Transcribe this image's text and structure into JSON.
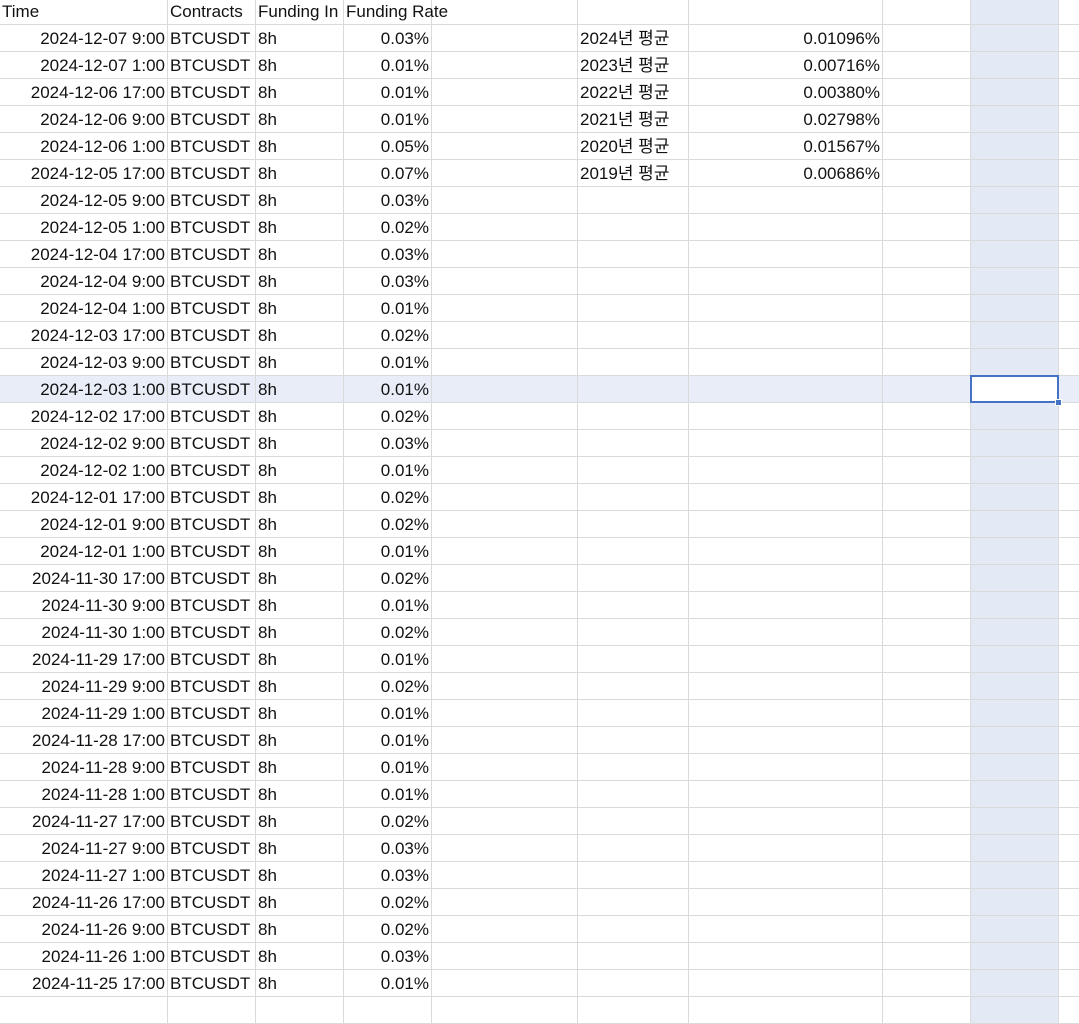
{
  "spreadsheet": {
    "headers": [
      "Time",
      "Contracts",
      "Funding In",
      "Funding Rate"
    ],
    "rows": [
      [
        "2024-12-07 9:00",
        "BTCUSDT",
        "8h",
        "0.03%"
      ],
      [
        "2024-12-07 1:00",
        "BTCUSDT",
        "8h",
        "0.01%"
      ],
      [
        "2024-12-06 17:00",
        "BTCUSDT",
        "8h",
        "0.01%"
      ],
      [
        "2024-12-06 9:00",
        "BTCUSDT",
        "8h",
        "0.01%"
      ],
      [
        "2024-12-06 1:00",
        "BTCUSDT",
        "8h",
        "0.05%"
      ],
      [
        "2024-12-05 17:00",
        "BTCUSDT",
        "8h",
        "0.07%"
      ],
      [
        "2024-12-05 9:00",
        "BTCUSDT",
        "8h",
        "0.03%"
      ],
      [
        "2024-12-05 1:00",
        "BTCUSDT",
        "8h",
        "0.02%"
      ],
      [
        "2024-12-04 17:00",
        "BTCUSDT",
        "8h",
        "0.03%"
      ],
      [
        "2024-12-04 9:00",
        "BTCUSDT",
        "8h",
        "0.03%"
      ],
      [
        "2024-12-04 1:00",
        "BTCUSDT",
        "8h",
        "0.01%"
      ],
      [
        "2024-12-03 17:00",
        "BTCUSDT",
        "8h",
        "0.02%"
      ],
      [
        "2024-12-03 9:00",
        "BTCUSDT",
        "8h",
        "0.01%"
      ],
      [
        "2024-12-03 1:00",
        "BTCUSDT",
        "8h",
        "0.01%"
      ],
      [
        "2024-12-02 17:00",
        "BTCUSDT",
        "8h",
        "0.02%"
      ],
      [
        "2024-12-02 9:00",
        "BTCUSDT",
        "8h",
        "0.03%"
      ],
      [
        "2024-12-02 1:00",
        "BTCUSDT",
        "8h",
        "0.01%"
      ],
      [
        "2024-12-01 17:00",
        "BTCUSDT",
        "8h",
        "0.02%"
      ],
      [
        "2024-12-01 9:00",
        "BTCUSDT",
        "8h",
        "0.02%"
      ],
      [
        "2024-12-01 1:00",
        "BTCUSDT",
        "8h",
        "0.01%"
      ],
      [
        "2024-11-30 17:00",
        "BTCUSDT",
        "8h",
        "0.02%"
      ],
      [
        "2024-11-30 9:00",
        "BTCUSDT",
        "8h",
        "0.01%"
      ],
      [
        "2024-11-30 1:00",
        "BTCUSDT",
        "8h",
        "0.02%"
      ],
      [
        "2024-11-29 17:00",
        "BTCUSDT",
        "8h",
        "0.01%"
      ],
      [
        "2024-11-29 9:00",
        "BTCUSDT",
        "8h",
        "0.02%"
      ],
      [
        "2024-11-29 1:00",
        "BTCUSDT",
        "8h",
        "0.01%"
      ],
      [
        "2024-11-28 17:00",
        "BTCUSDT",
        "8h",
        "0.01%"
      ],
      [
        "2024-11-28 9:00",
        "BTCUSDT",
        "8h",
        "0.01%"
      ],
      [
        "2024-11-28 1:00",
        "BTCUSDT",
        "8h",
        "0.01%"
      ],
      [
        "2024-11-27 17:00",
        "BTCUSDT",
        "8h",
        "0.02%"
      ],
      [
        "2024-11-27 9:00",
        "BTCUSDT",
        "8h",
        "0.03%"
      ],
      [
        "2024-11-27 1:00",
        "BTCUSDT",
        "8h",
        "0.03%"
      ],
      [
        "2024-11-26 17:00",
        "BTCUSDT",
        "8h",
        "0.02%"
      ],
      [
        "2024-11-26 9:00",
        "BTCUSDT",
        "8h",
        "0.02%"
      ],
      [
        "2024-11-26 1:00",
        "BTCUSDT",
        "8h",
        "0.03%"
      ],
      [
        "2024-11-25 17:00",
        "BTCUSDT",
        "8h",
        "0.01%"
      ]
    ],
    "averages": [
      [
        "2024년 평균",
        "0.01096%"
      ],
      [
        "2023년 평균",
        "0.00716%"
      ],
      [
        "2022년 평균",
        "0.00380%"
      ],
      [
        "2021년 평균",
        "0.02798%"
      ],
      [
        "2020년 평균",
        "0.01567%"
      ],
      [
        "2019년 평균",
        "0.00686%"
      ]
    ],
    "selected_row_index": 14,
    "selection_color": "#4472c4",
    "highlight_color": "#e4e9f6"
  }
}
